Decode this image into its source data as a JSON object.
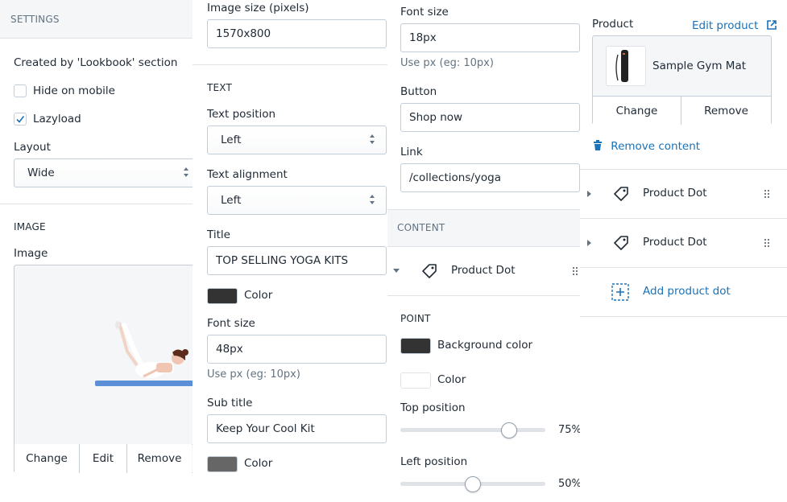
{
  "settings": {
    "header": "SETTINGS",
    "created_by": "Created by 'Lookbook' section",
    "hide_on_mobile": {
      "label": "Hide on mobile",
      "checked": false
    },
    "lazyload": {
      "label": "Lazyload",
      "checked": true
    },
    "layout": {
      "label": "Layout",
      "value": "Wide"
    },
    "image_section": "IMAGE",
    "image_label": "Image",
    "image_buttons": {
      "change": "Change",
      "edit": "Edit",
      "remove": "Remove"
    }
  },
  "text_panel": {
    "image_size": {
      "label": "Image size (pixels)",
      "value": "1570x800"
    },
    "section": "TEXT",
    "text_position": {
      "label": "Text position",
      "value": "Left"
    },
    "text_alignment": {
      "label": "Text alignment",
      "value": "Left"
    },
    "title": {
      "label": "Title",
      "value": "TOP SELLING YOGA KITS"
    },
    "title_color": {
      "label": "Color",
      "hex": "#333333"
    },
    "font_size": {
      "label": "Font size",
      "value": "48px",
      "help": "Use px (eg: 10px)"
    },
    "sub_title": {
      "label": "Sub title",
      "value": "Keep Your Cool Kit"
    },
    "sub_title_color": {
      "label": "Color",
      "hex": "#666666"
    }
  },
  "button_panel": {
    "font_size": {
      "label": "Font size",
      "value": "18px",
      "help": "Use px (eg: 10px)"
    },
    "button": {
      "label": "Button",
      "value": "Shop now"
    },
    "link": {
      "label": "Link",
      "value": "/collections/yoga"
    },
    "content_header": "CONTENT",
    "content_item": "Product Dot",
    "point_section": "POINT",
    "background_color": {
      "label": "Background color",
      "hex": "#333333"
    },
    "color": {
      "label": "Color",
      "hex": "#ffffff"
    },
    "top_position": {
      "label": "Top position",
      "value": 75,
      "display": "75%"
    },
    "left_position": {
      "label": "Left position",
      "value": 50,
      "display": "50%"
    }
  },
  "product_panel": {
    "product_label": "Product",
    "edit_product": "Edit product",
    "product_name": "Sample Gym Mat",
    "change": "Change",
    "remove": "Remove",
    "remove_content": "Remove content",
    "dots": [
      "Product Dot",
      "Product Dot"
    ],
    "add_product_dot": "Add product dot"
  },
  "colors": {
    "accent": "#1a72b8",
    "border": "#c4cdd5",
    "divider": "#dfe3e8",
    "text": "#212b36"
  }
}
